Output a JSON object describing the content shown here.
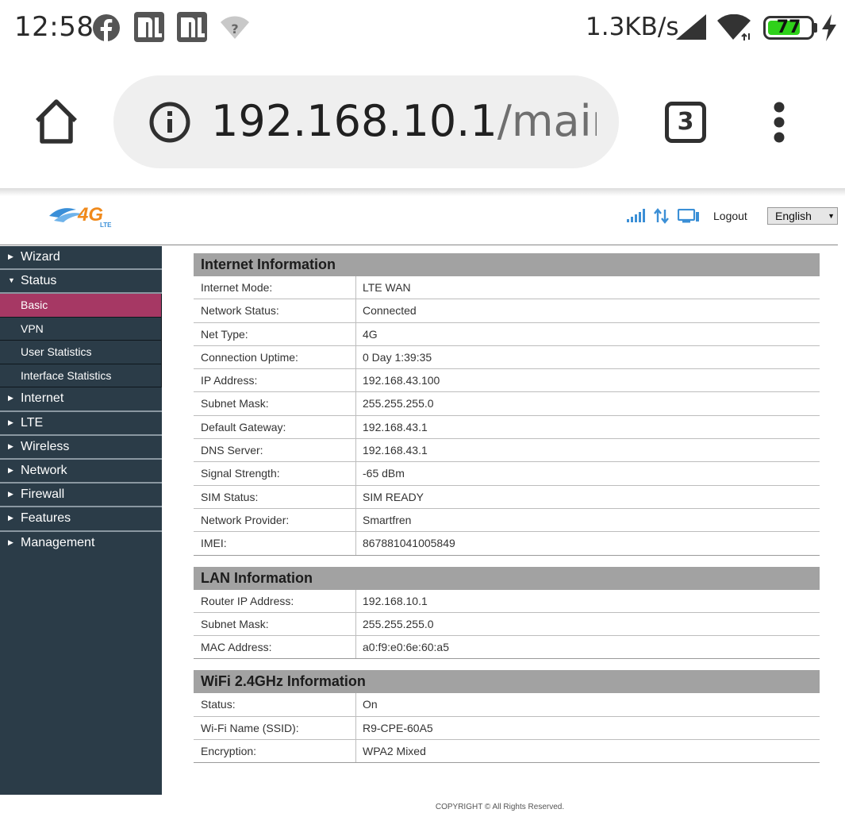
{
  "status_bar": {
    "time": "12:58",
    "net_speed": "1.3KB/s",
    "battery_level": "77",
    "battery_fraction": 0.77,
    "icons": [
      "facebook-icon",
      "mi-icon",
      "mi-icon",
      "wifi-question-icon",
      "cell-signal-icon",
      "wifi-icon",
      "battery-icon",
      "charging-bolt-icon"
    ]
  },
  "browser": {
    "url_host": "192.168.10.1",
    "url_path": "/main.htm",
    "tab_count": "3"
  },
  "router_header": {
    "logo_text": "4G LTE",
    "logout_label": "Logout",
    "language": "English"
  },
  "sidebar": {
    "items": [
      {
        "label": "Wizard",
        "expanded": false
      },
      {
        "label": "Status",
        "expanded": true,
        "children": [
          {
            "label": "Basic",
            "active": true
          },
          {
            "label": "VPN"
          },
          {
            "label": "User Statistics"
          },
          {
            "label": "Interface Statistics"
          }
        ]
      },
      {
        "label": "Internet",
        "expanded": false
      },
      {
        "label": "LTE",
        "expanded": false
      },
      {
        "label": "Wireless",
        "expanded": false
      },
      {
        "label": "Network",
        "expanded": false
      },
      {
        "label": "Firewall",
        "expanded": false
      },
      {
        "label": "Features",
        "expanded": false
      },
      {
        "label": "Management",
        "expanded": false
      }
    ]
  },
  "sections": [
    {
      "title": "Internet Information",
      "rows": [
        {
          "label": "Internet Mode:",
          "value": "LTE WAN"
        },
        {
          "label": "Network Status:",
          "value": "Connected"
        },
        {
          "label": "Net Type:",
          "value": "4G"
        },
        {
          "label": "Connection Uptime:",
          "value": "0 Day 1:39:35"
        },
        {
          "label": "IP Address:",
          "value": "192.168.43.100"
        },
        {
          "label": "Subnet Mask:",
          "value": "255.255.255.0"
        },
        {
          "label": "Default Gateway:",
          "value": "192.168.43.1"
        },
        {
          "label": "DNS Server:",
          "value": "192.168.43.1"
        },
        {
          "label": "Signal Strength:",
          "value": "-65 dBm"
        },
        {
          "label": "SIM Status:",
          "value": "SIM READY"
        },
        {
          "label": "Network Provider:",
          "value": "Smartfren"
        },
        {
          "label": "IMEI:",
          "value": "867881041005849"
        }
      ]
    },
    {
      "title": "LAN Information",
      "rows": [
        {
          "label": "Router IP Address:",
          "value": "192.168.10.1"
        },
        {
          "label": "Subnet Mask:",
          "value": "255.255.255.0"
        },
        {
          "label": "MAC Address:",
          "value": "a0:f9:e0:6e:60:a5"
        }
      ]
    },
    {
      "title": "WiFi 2.4GHz Information",
      "rows": [
        {
          "label": "Status:",
          "value": "On"
        },
        {
          "label": "Wi-Fi Name (SSID):",
          "value": "R9-CPE-60A5"
        },
        {
          "label": "Encryption:",
          "value": "WPA2 Mixed"
        }
      ]
    }
  ],
  "footer": "COPYRIGHT © All Rights Reserved.",
  "colors": {
    "sidebar_bg": "#2b3c48",
    "active_item": "#a63864",
    "section_header": "#a2a2a2",
    "battery_green": "#2fd11a",
    "header_icons_blue": "#3b8fd6"
  }
}
